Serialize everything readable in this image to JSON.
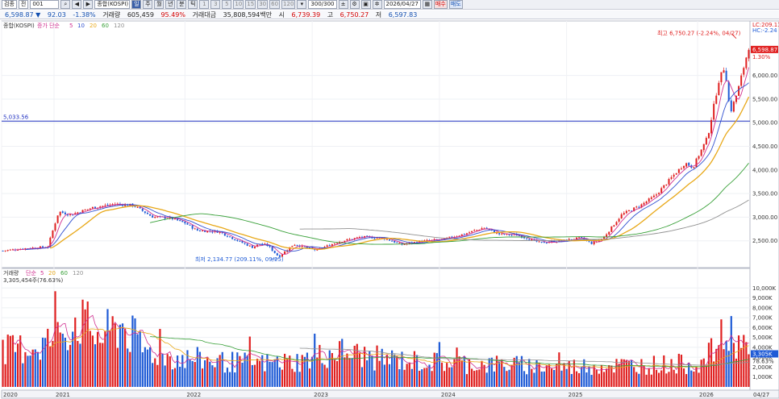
{
  "toolbar": {
    "search_label": "검종",
    "period_label": "전",
    "code_value": "001",
    "index_name": "종합(KOSPI)",
    "period_day": "일",
    "period_week": "주",
    "period_month": "월",
    "period_year": "년",
    "period_minute": "분",
    "period_tick": "틱",
    "interval_1": "1",
    "interval_3": "3",
    "interval_5": "5",
    "interval_10": "10",
    "interval_15": "15",
    "interval_30": "30",
    "interval_60": "60",
    "interval_120": "120",
    "count_value": "300/300",
    "date_value": "2026/04/27",
    "buy_label": "매수",
    "sell_label": "매도"
  },
  "quote": {
    "price": "6,598.87 ▼",
    "change": "92.03",
    "change_pct": "-1.38%",
    "volume_label": "거래량",
    "volume": "605,459",
    "volume_ratio": "95.49%",
    "amount_label": "거래대금",
    "amount": "35,808,594백만",
    "open_label": "시",
    "open": "6,739.39",
    "high_label": "고",
    "high": "6,750.27",
    "low_label": "저",
    "low": "6,597.83"
  },
  "colors": {
    "up": "#e02020",
    "down": "#1f5bd6",
    "ma5": "#d03090",
    "ma10": "#3050d0",
    "ma20": "#e8a818",
    "ma60": "#38a038",
    "ma120": "#909090",
    "hline": "#2030c0"
  },
  "chart_data": [
    {
      "type": "candlestick",
      "legend_name": "종합(KOSPI)",
      "ma_label": "증가 단순",
      "ma_periods": [
        "5",
        "10",
        "20",
        "60",
        "120"
      ],
      "y_ticks": [
        "6,000.00",
        "5,500.00",
        "5,000.00",
        "4,500.00",
        "4,000.00",
        "3,500.00",
        "3,000.00",
        "2,500.00"
      ],
      "ylim": [
        2000,
        6950
      ],
      "last_price_label": "6,598.87",
      "last_pct_label": "1.30%",
      "lc_label": "LC:209.11",
      "hc_label": "HC:-2.24",
      "horizontal_line_label": "5,033.56",
      "horizontal_line_value": 5033.56,
      "high_annotation": "최고 6,750.27 (-2.24%, 04/27)",
      "high_value": 6750.27,
      "low_annotation": "최저 2,134.77 (209.11%, 09/25)",
      "low_value": 2134.77,
      "x_ticks": [
        "2020",
        "2021",
        "2022",
        "2023",
        "2024",
        "2025",
        "2026"
      ],
      "last_date_label": "04/27",
      "anchors": [
        {
          "t": 0.0,
          "v": 2290
        },
        {
          "t": 0.03,
          "v": 2340
        },
        {
          "t": 0.06,
          "v": 2370
        },
        {
          "t": 0.075,
          "v": 3120
        },
        {
          "t": 0.09,
          "v": 3050
        },
        {
          "t": 0.12,
          "v": 3200
        },
        {
          "t": 0.15,
          "v": 3280
        },
        {
          "t": 0.175,
          "v": 3250
        },
        {
          "t": 0.2,
          "v": 3010
        },
        {
          "t": 0.225,
          "v": 2980
        },
        {
          "t": 0.245,
          "v": 2870
        },
        {
          "t": 0.26,
          "v": 2720
        },
        {
          "t": 0.29,
          "v": 2690
        },
        {
          "t": 0.315,
          "v": 2500
        },
        {
          "t": 0.335,
          "v": 2360
        },
        {
          "t": 0.345,
          "v": 2440
        },
        {
          "t": 0.355,
          "v": 2400
        },
        {
          "t": 0.37,
          "v": 2160
        },
        {
          "t": 0.39,
          "v": 2430
        },
        {
          "t": 0.42,
          "v": 2300
        },
        {
          "t": 0.45,
          "v": 2480
        },
        {
          "t": 0.48,
          "v": 2580
        },
        {
          "t": 0.51,
          "v": 2560
        },
        {
          "t": 0.535,
          "v": 2420
        },
        {
          "t": 0.56,
          "v": 2490
        },
        {
          "t": 0.59,
          "v": 2530
        },
        {
          "t": 0.62,
          "v": 2650
        },
        {
          "t": 0.645,
          "v": 2780
        },
        {
          "t": 0.665,
          "v": 2640
        },
        {
          "t": 0.69,
          "v": 2620
        },
        {
          "t": 0.72,
          "v": 2460
        },
        {
          "t": 0.75,
          "v": 2500
        },
        {
          "t": 0.775,
          "v": 2560
        },
        {
          "t": 0.79,
          "v": 2440
        },
        {
          "t": 0.805,
          "v": 2560
        },
        {
          "t": 0.83,
          "v": 3060
        },
        {
          "t": 0.855,
          "v": 3250
        },
        {
          "t": 0.875,
          "v": 3460
        },
        {
          "t": 0.9,
          "v": 3900
        },
        {
          "t": 0.915,
          "v": 4150
        },
        {
          "t": 0.925,
          "v": 4050
        },
        {
          "t": 0.945,
          "v": 4700
        },
        {
          "t": 0.96,
          "v": 5900
        },
        {
          "t": 0.968,
          "v": 6200
        },
        {
          "t": 0.975,
          "v": 5200
        },
        {
          "t": 0.985,
          "v": 5650
        },
        {
          "t": 1.0,
          "v": 6600
        }
      ]
    },
    {
      "type": "bar",
      "legend_name": "거래량",
      "ma_label": "단순",
      "ma_periods": [
        "5",
        "20",
        "60",
        "120"
      ],
      "current_label": "3,305,454주(76.63%)",
      "y_ticks": [
        "10,000K",
        "9,000K",
        "8,000K",
        "7,000K",
        "6,000K",
        "5,000K",
        "4,000K",
        "3,000K",
        "2,000K",
        "1,000K"
      ],
      "ylim": [
        0,
        11000
      ],
      "last_volume_label": "3,305K",
      "last_pct_label": "78.63%",
      "anchors": [
        {
          "t": 0.0,
          "v": 3600
        },
        {
          "t": 0.05,
          "v": 4200
        },
        {
          "t": 0.08,
          "v": 5400
        },
        {
          "t": 0.1,
          "v": 6900
        },
        {
          "t": 0.13,
          "v": 5000
        },
        {
          "t": 0.16,
          "v": 6300
        },
        {
          "t": 0.19,
          "v": 3700
        },
        {
          "t": 0.23,
          "v": 2900
        },
        {
          "t": 0.26,
          "v": 2800
        },
        {
          "t": 0.3,
          "v": 2500
        },
        {
          "t": 0.35,
          "v": 2400
        },
        {
          "t": 0.4,
          "v": 2600
        },
        {
          "t": 0.45,
          "v": 3600
        },
        {
          "t": 0.5,
          "v": 2900
        },
        {
          "t": 0.55,
          "v": 2600
        },
        {
          "t": 0.6,
          "v": 2400
        },
        {
          "t": 0.65,
          "v": 2300
        },
        {
          "t": 0.7,
          "v": 2200
        },
        {
          "t": 0.75,
          "v": 2000
        },
        {
          "t": 0.8,
          "v": 2200
        },
        {
          "t": 0.85,
          "v": 2200
        },
        {
          "t": 0.9,
          "v": 2300
        },
        {
          "t": 0.94,
          "v": 2400
        },
        {
          "t": 0.96,
          "v": 4600
        },
        {
          "t": 0.98,
          "v": 5500
        },
        {
          "t": 1.0,
          "v": 3300
        }
      ]
    }
  ]
}
